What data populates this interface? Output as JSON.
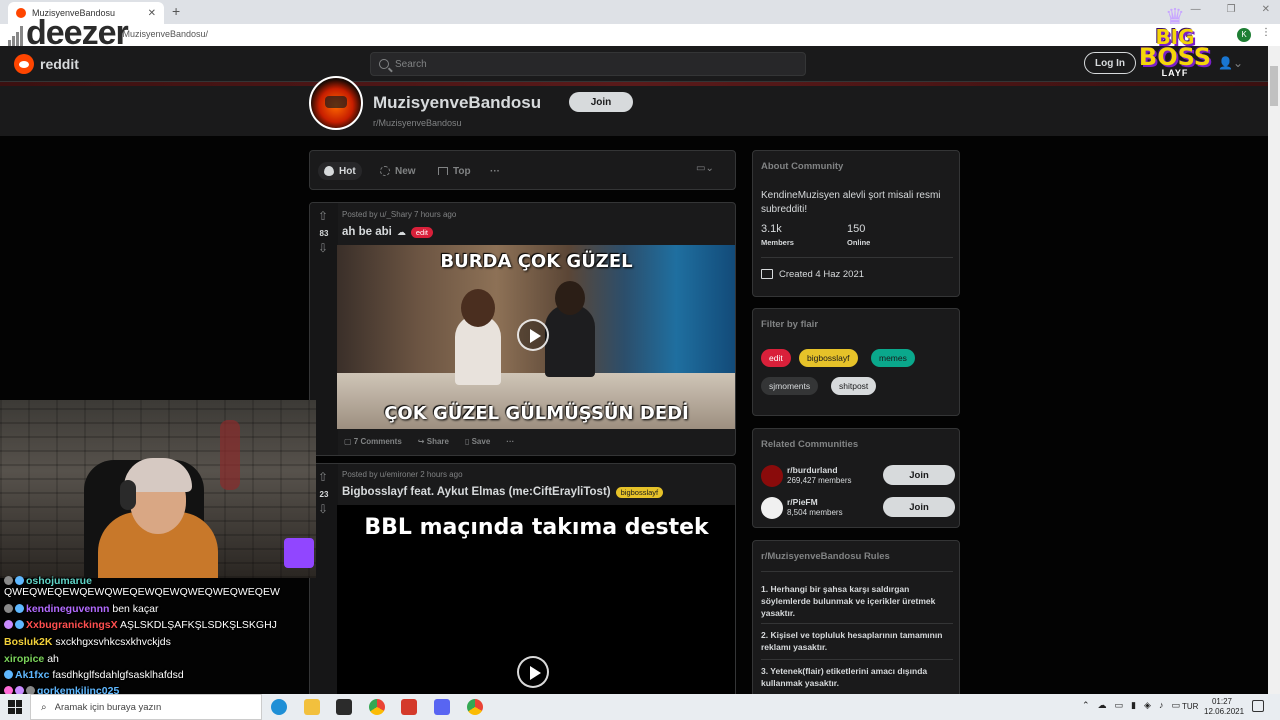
{
  "browser": {
    "tab_title": "MuzisyenveBandosu",
    "url": "/MuzisyenveBandosu/",
    "profile_initial": "K"
  },
  "overlays": {
    "deezer_logo": "deezer",
    "bigboss_line1": "BIG",
    "bigboss_line2": "BOSS",
    "bigboss_line3": "LAYF"
  },
  "header": {
    "brand": "reddit",
    "search_placeholder": "Search",
    "login_label": "Log In"
  },
  "community": {
    "name": "MuzisyenveBandosu",
    "subreddit": "r/MuzisyenveBandosu",
    "join_label": "Join"
  },
  "sort": {
    "hot": "Hot",
    "new": "New",
    "top": "Top",
    "more": "···"
  },
  "posts": [
    {
      "meta": "Posted by u/_Shary 7 hours ago",
      "votes": "83",
      "title": "ah be abi",
      "flair": "edit",
      "flair_color": "#d9203a",
      "caption_top": "BURDA ÇOK GÜZEL",
      "caption_bottom": "ÇOK GÜZEL GÜLMÜŞSÜN DEDİ",
      "comments": "7 Comments",
      "share": "Share",
      "save": "Save",
      "more": "···"
    },
    {
      "meta": "Posted by u/emironer 2 hours ago",
      "votes": "23",
      "title": "Bigbosslayf feat. Aykut Elmas (me:CiftErayliTost)",
      "flair": "bigbosslayf",
      "flair_color": "#e6c229",
      "caption_top": "BBL maçında takıma destek"
    }
  ],
  "about": {
    "title": "About Community",
    "description": "KendineMuzisyen alevli şort misali resmi subredditi!",
    "members_value": "3.1k",
    "members_label": "Members",
    "online_value": "150",
    "online_label": "Online",
    "created": "Created 4 Haz 2021"
  },
  "flair_filter": {
    "title": "Filter by flair",
    "flairs": [
      {
        "label": "edit",
        "bg": "#d9203a",
        "fg": "#ffffff"
      },
      {
        "label": "bigbosslayf",
        "bg": "#e6c229",
        "fg": "#1a1a1b"
      },
      {
        "label": "memes",
        "bg": "#0aa88c",
        "fg": "#1a1a1b"
      },
      {
        "label": "sjmoments",
        "bg": "#343536",
        "fg": "#d7dadc"
      },
      {
        "label": "shitpost",
        "bg": "#d7dadc",
        "fg": "#1a1a1b"
      }
    ]
  },
  "related": {
    "title": "Related Communities",
    "items": [
      {
        "name": "r/burdurland",
        "members": "269,427 members",
        "join": "Join"
      },
      {
        "name": "r/PieFM",
        "members": "8,504 members",
        "join": "Join"
      }
    ]
  },
  "rules": {
    "title": "r/MuzisyenveBandosu Rules",
    "items": [
      "1. Herhangi bir şahsa karşı saldırgan söylemlerde bulunmak ve içerikler üretmek yasaktır.",
      "2. Kişisel ve topluluk hesaplarının tamamının reklamı yasaktır.",
      "3. Yetenek(flair) etiketlerini amacı dışında kullanmak yasaktır."
    ]
  },
  "chat": [
    {
      "user": "oshojumarue",
      "msg": "",
      "color": "#5fd3c6"
    },
    {
      "user": "",
      "msg": "QWEQWEQEWQEWQWEQEWQEWQWEQWEQWEQEW",
      "color": "#ffffff"
    },
    {
      "user": "kendineguvennn",
      "msg": "ben kaçar",
      "color": "#b36bff"
    },
    {
      "user": "XxbugranickingsX",
      "msg": "AŞLSKDLŞAFKŞLSDKŞLSKGHJ",
      "color": "#ff4f4f"
    },
    {
      "user": "Bosluk2K",
      "msg": "sxckhgxsvhkcsxkhvckjds",
      "color": "#f2d13a"
    },
    {
      "user": "xiropice",
      "msg": "ah",
      "color": "#7bd35a"
    },
    {
      "user": "Ak1fxc",
      "msg": "fasdhkglfsdahlgfsasklhafdsd",
      "color": "#5fb8ff"
    },
    {
      "user": "gorkemkilinc025",
      "msg": "",
      "color": "#5fb8ff"
    }
  ],
  "taskbar": {
    "search_placeholder": "Aramak için buraya yazın",
    "lang": "TUR",
    "time": "01:27",
    "date": "12.06.2021"
  }
}
